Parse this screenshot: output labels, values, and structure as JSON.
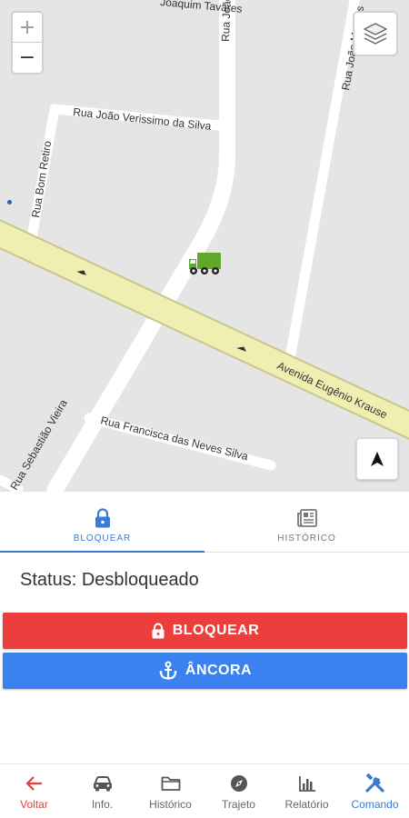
{
  "map": {
    "zoom_in": "+",
    "zoom_out": "−",
    "streets": [
      "Joaquim Tavares",
      "Rua João Vieira",
      "Rua João Verissimo da Silva",
      "Rua Bom Retiro",
      "Rua João Martins",
      "Avenida Eugênio Krause",
      "Rua Francisca das Neves Silva",
      "Rua Sebastião Vieira"
    ],
    "vehicle_color": "#5fa82c"
  },
  "tabs": [
    {
      "label": "BLOQUEAR",
      "icon": "lock-icon",
      "active": true
    },
    {
      "label": "HISTÓRICO",
      "icon": "newspaper-icon",
      "active": false
    }
  ],
  "status_text": "Status: Desbloqueado",
  "buttons": {
    "lock": {
      "label": "BLOQUEAR",
      "icon": "lock-icon",
      "color": "#ed3e3e"
    },
    "anchor": {
      "label": "ÂNCORA",
      "icon": "anchor-icon",
      "color": "#3b82f0"
    }
  },
  "nav": [
    {
      "label": "Voltar",
      "icon": "arrow-left-icon"
    },
    {
      "label": "Info.",
      "icon": "car-icon"
    },
    {
      "label": "Histórico",
      "icon": "folder-icon"
    },
    {
      "label": "Trajeto",
      "icon": "compass-icon"
    },
    {
      "label": "Relatório",
      "icon": "bar-chart-icon"
    },
    {
      "label": "Comando",
      "icon": "tools-icon"
    }
  ],
  "colors": {
    "accent": "#3a7bd5",
    "danger": "#ed3e3e",
    "panel_edge": "#2d6bb9"
  }
}
